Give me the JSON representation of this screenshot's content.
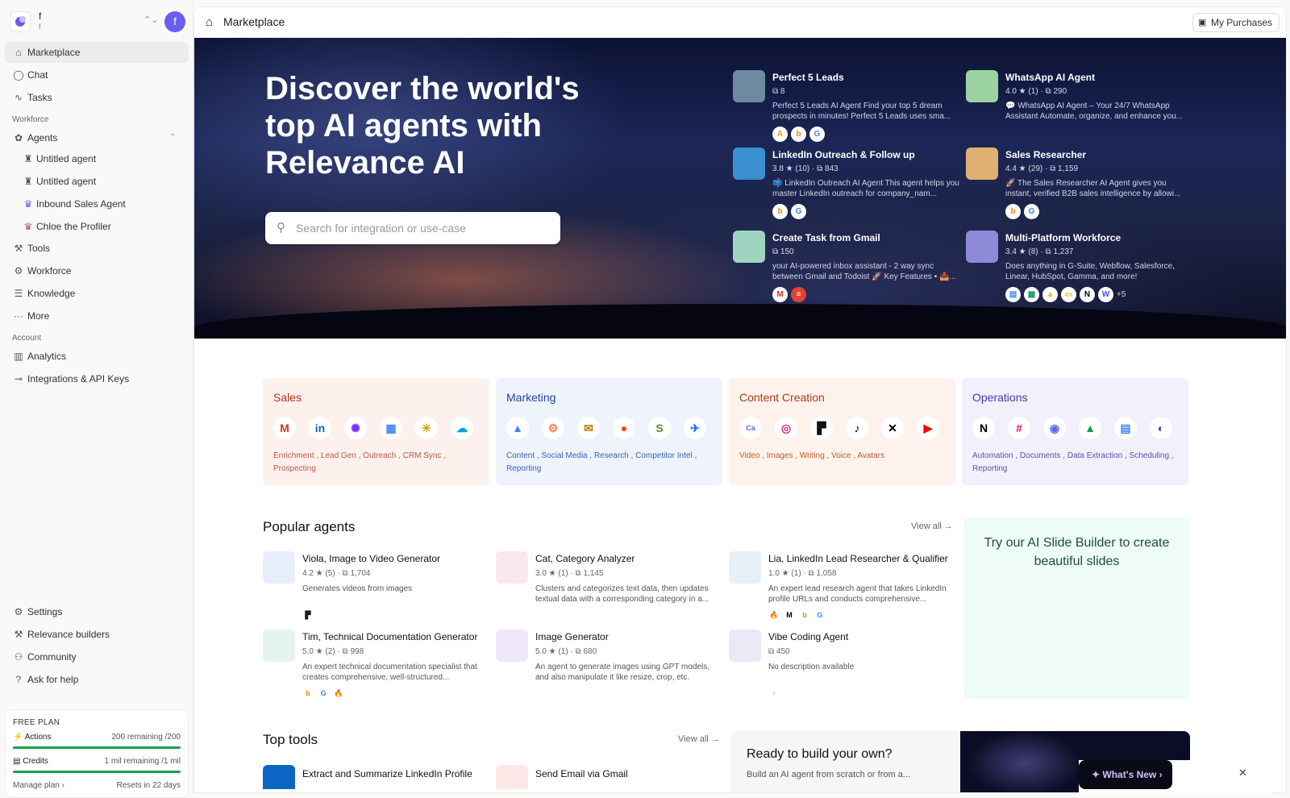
{
  "workspace": {
    "name": "f",
    "sub": "f",
    "avatar": "f"
  },
  "nav": {
    "main": [
      {
        "label": "Marketplace",
        "icon": "store-icon"
      },
      {
        "label": "Chat",
        "icon": "chat-icon"
      },
      {
        "label": "Tasks",
        "icon": "activity-icon"
      }
    ],
    "workforce_section": "Workforce",
    "agents": {
      "label": "Agents",
      "items": [
        "Untitled agent",
        "Untitled agent",
        "Inbound Sales Agent",
        "Chloe the Profiler"
      ]
    },
    "more_items": [
      {
        "label": "Tools"
      },
      {
        "label": "Workforce"
      },
      {
        "label": "Knowledge"
      },
      {
        "label": "More"
      }
    ],
    "account_section": "Account",
    "account_items": [
      {
        "label": "Analytics"
      },
      {
        "label": "Integrations & API Keys"
      }
    ],
    "bottom_items": [
      {
        "label": "Settings"
      },
      {
        "label": "Relevance builders"
      },
      {
        "label": "Community"
      },
      {
        "label": "Ask for help"
      }
    ]
  },
  "plan": {
    "title": "FREE PLAN",
    "actions_label": "Actions",
    "actions_value": "200 remaining /200",
    "actions_fraction": 1.0,
    "credits_label": "Credits",
    "credits_value": "1 mil remaining /1 mil",
    "credits_fraction": 1.0,
    "manage": "Manage plan",
    "resets": "Resets in 22 days"
  },
  "topbar": {
    "title": "Marketplace",
    "purchases": "My Purchases"
  },
  "hero": {
    "title": "Discover the world's top AI agents with Relevance AI",
    "search_placeholder": "Search for integration or use-case"
  },
  "featured": [
    {
      "name": "Perfect 5 Leads",
      "stats": "⧉ 8",
      "desc": "Perfect 5 Leads AI Agent Find your top 5 dream prospects in minutes! Perfect 5 Leads uses sma..."
    },
    {
      "name": "WhatsApp AI Agent",
      "stats": "4.0 ★ (1) · ⧉ 290",
      "desc": "💬 WhatsApp AI Agent – Your 24/7 WhatsApp Assistant Automate, organize, and enhance you..."
    },
    {
      "name": "LinkedIn Outreach & Follow up",
      "stats": "3.8 ★ (10) · ⧉ 843",
      "desc": "📫 LinkedIn Outreach AI Agent This agent helps you master LinkedIn outreach for company_nam..."
    },
    {
      "name": "Sales Researcher",
      "stats": "4.4 ★ (29) · ⧉ 1,159",
      "desc": "🚀 The Sales Researcher AI Agent gives you instant, verified B2B sales intelligence by allowi..."
    },
    {
      "name": "Create Task from Gmail",
      "stats": "⧉ 150",
      "desc": "your AI-powered inbox assistant - 2 way sync between Gmail and Todoist 🚀 Key Features • 📥..."
    },
    {
      "name": "Multi-Platform Workforce",
      "stats": "3.4 ★ (8) · ⧉ 1,237",
      "desc": "Does anything in G-Suite, Webflow, Salesforce, Linear, HubSpot, Gamma, and more!",
      "extra": "+5"
    }
  ],
  "categories": [
    {
      "name": "Sales",
      "tags": "Enrichment , Lead Gen , Outreach , CRM Sync , Prospecting"
    },
    {
      "name": "Marketing",
      "tags": "Content , Social Media , Research , Competitor Intel , Reporting"
    },
    {
      "name": "Content Creation",
      "tags": "Video , Images , Writing , Voice , Avatars"
    },
    {
      "name": "Operations",
      "tags": "Automation , Documents , Data Extraction , Scheduling , Reporting"
    }
  ],
  "popular": {
    "title": "Popular agents",
    "view_all": "View all →",
    "items": [
      {
        "name": "Viola, Image to Video Generator",
        "stats": "4.2 ★ (5) · ⧉ 1,704",
        "desc": "Generates videos from images"
      },
      {
        "name": "Cat, Category Analyzer",
        "stats": "3.0 ★ (1) · ⧉ 1,145",
        "desc": "Clusters and categorizes text data, then updates textual data with a corresponding category in a..."
      },
      {
        "name": "Lia, LinkedIn Lead Researcher & Qualifier",
        "stats": "1.0 ★ (1) · ⧉ 1,058",
        "desc": "An expert lead research agent that takes LinkedIn profile URLs and conducts comprehensive..."
      },
      {
        "name": "Tim, Technical Documentation Generator",
        "stats": "5.0 ★ (2) · ⧉ 998",
        "desc": "An expert technical documentation specialist that creates comprehensive, well-structured..."
      },
      {
        "name": "Image Generator",
        "stats": "5.0 ★ (1) · ⧉ 680",
        "desc": "An agent to generate images using GPT models, and also manipulate it like resize, crop, etc."
      },
      {
        "name": "Vibe Coding Agent",
        "stats": "⧉ 450",
        "desc": "No description available"
      }
    ]
  },
  "slide_builder": {
    "text": "Try our AI Slide Builder to create beautiful slides"
  },
  "top_tools": {
    "title": "Top tools",
    "view_all": "View all →",
    "items": [
      {
        "name": "Extract and Summarize LinkedIn Profile"
      },
      {
        "name": "Send Email via Gmail"
      }
    ]
  },
  "ready": {
    "title": "Ready to build your own?",
    "sub": "Build an AI agent from scratch or from a..."
  },
  "whats_new": {
    "label": "✦ What's New ›",
    "close": "✕"
  },
  "colors": {
    "accent": "#6a5df2",
    "sales_bg": "#fdf1ee",
    "sales_fg": "#b4321c",
    "marketing_bg": "#eef3fc",
    "marketing_fg": "#1f46a8",
    "content_bg": "#fdf3ec",
    "content_fg": "#b23a10",
    "ops_bg": "#f1f0fb",
    "ops_fg": "#4638b0"
  }
}
